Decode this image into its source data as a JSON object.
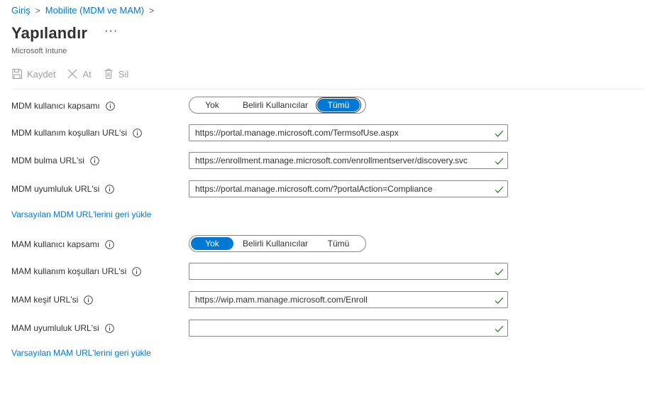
{
  "breadcrumb": {
    "home": "Giriş",
    "parent": "Mobilite (MDM ve MAM)"
  },
  "page": {
    "title": "Yapılandır",
    "more": "···",
    "subtitle": "Microsoft Intune"
  },
  "toolbar": {
    "save": "Kaydet",
    "discard": "At",
    "delete": "Sil"
  },
  "mdm": {
    "scope": {
      "label": "MDM kullanıcı kapsamı",
      "options": [
        "Yok",
        "Belirli Kullanıcılar",
        "Tümü"
      ],
      "selected": "Tümü"
    },
    "terms": {
      "label": "MDM kullanım koşulları URL'si",
      "value": "https://portal.manage.microsoft.com/TermsofUse.aspx"
    },
    "discovery": {
      "label": "MDM bulma URL'si",
      "value": "https://enrollment.manage.microsoft.com/enrollmentserver/discovery.svc"
    },
    "compliance": {
      "label": "MDM uyumluluk URL'si",
      "value": "https://portal.manage.microsoft.com/?portalAction=Compliance"
    },
    "restore": "Varsayılan MDM URL'lerini geri yükle"
  },
  "mam": {
    "scope": {
      "label": "MAM kullanıcı kapsamı",
      "options": [
        "Yok",
        "Belirli Kullanıcılar",
        "Tümü"
      ],
      "selected": "Yok"
    },
    "terms": {
      "label": "MAM kullanım koşulları URL'si",
      "value": ""
    },
    "discovery": {
      "label": "MAM keşif URL'si",
      "value": "https://wip.mam.manage.microsoft.com/Enroll"
    },
    "compliance": {
      "label": "MAM uyumluluk URL'si",
      "value": ""
    },
    "restore": "Varsayılan MAM URL'lerini geri yükle"
  },
  "colors": {
    "accent": "#0078d4",
    "valid": "#107c10",
    "disabled": "#a19f9d"
  },
  "icons": {
    "save": "save-icon",
    "discard": "close-icon",
    "delete": "trash-icon",
    "info": "info-icon",
    "valid": "checkmark-icon"
  }
}
